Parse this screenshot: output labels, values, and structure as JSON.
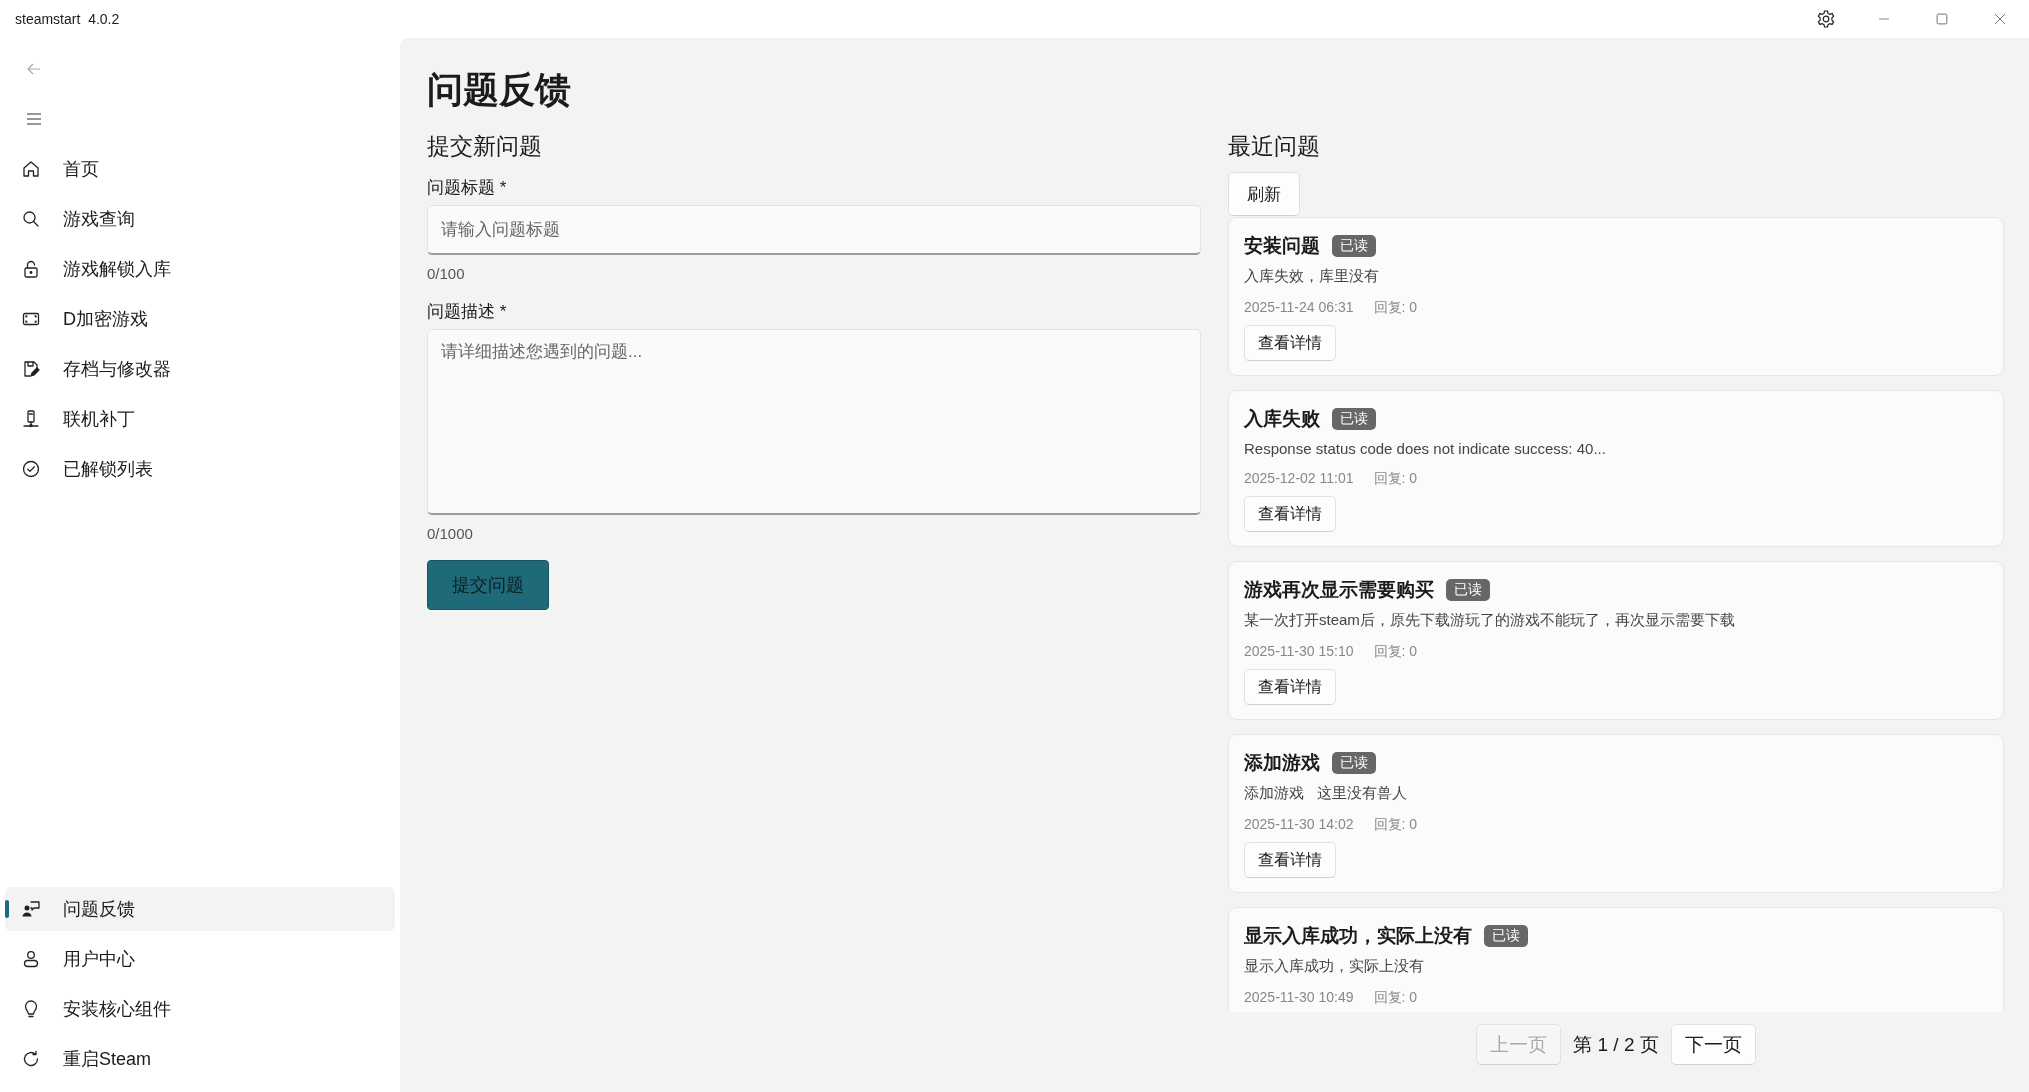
{
  "window": {
    "title": "steamstart  4.0.2"
  },
  "sidebar": {
    "items": [
      {
        "label": "首页",
        "kind": "home",
        "selected": false
      },
      {
        "label": "游戏查询",
        "kind": "search",
        "selected": false
      },
      {
        "label": "游戏解锁入库",
        "kind": "unlock",
        "selected": false
      },
      {
        "label": "D加密游戏",
        "kind": "frame",
        "selected": false
      },
      {
        "label": "存档与修改器",
        "kind": "save",
        "selected": false
      },
      {
        "label": "联机补丁",
        "kind": "network",
        "selected": false
      },
      {
        "label": "已解锁列表",
        "kind": "check",
        "selected": false
      }
    ],
    "footer_items": [
      {
        "label": "问题反馈",
        "kind": "feedback",
        "selected": true
      },
      {
        "label": "用户中心",
        "kind": "person",
        "selected": false
      },
      {
        "label": "安装核心组件",
        "kind": "bulb",
        "selected": false
      },
      {
        "label": "重启Steam",
        "kind": "restart",
        "selected": false
      }
    ]
  },
  "page": {
    "title": "问题反馈"
  },
  "form": {
    "heading": "提交新问题",
    "title_field": {
      "label": "问题标题 *",
      "placeholder": "请输入问题标题",
      "counter": "0/100"
    },
    "description_field": {
      "label": "问题描述 *",
      "placeholder": "请详细描述您遇到的问题...",
      "counter": "0/1000"
    },
    "submit": "提交问题"
  },
  "recent": {
    "heading": "最近问题",
    "refresh": "刷新",
    "issues": [
      {
        "title": "安装问题",
        "badge": "已读",
        "description": "入库失效，库里没有",
        "date": "2025-11-24 06:31",
        "replies": "回复: 0",
        "button": "查看详情"
      },
      {
        "title": "入库失败",
        "badge": "已读",
        "description": "Response status code does not indicate success: 40...",
        "date": "2025-12-02 11:01",
        "replies": "回复: 0",
        "button": "查看详情"
      },
      {
        "title": "游戏再次显示需要购买",
        "badge": "已读",
        "description": "某一次打开steam后，原先下载游玩了的游戏不能玩了，再次显示需要下载",
        "date": "2025-11-30 15:10",
        "replies": "回复: 0",
        "button": "查看详情"
      },
      {
        "title": "添加游戏",
        "badge": "已读",
        "description": "添加游戏   这里没有兽人",
        "date": "2025-11-30 14:02",
        "replies": "回复: 0",
        "button": "查看详情"
      },
      {
        "title": "显示入库成功，实际上没有",
        "badge": "已读",
        "description": "显示入库成功，实际上没有",
        "date": "2025-11-30 10:49",
        "replies": "回复: 0"
      }
    ],
    "pagination": {
      "previous": {
        "label": "上一页",
        "disabled": true
      },
      "page": "第 1 / 2 页",
      "next": {
        "label": "下一页",
        "disabled": false
      }
    }
  }
}
